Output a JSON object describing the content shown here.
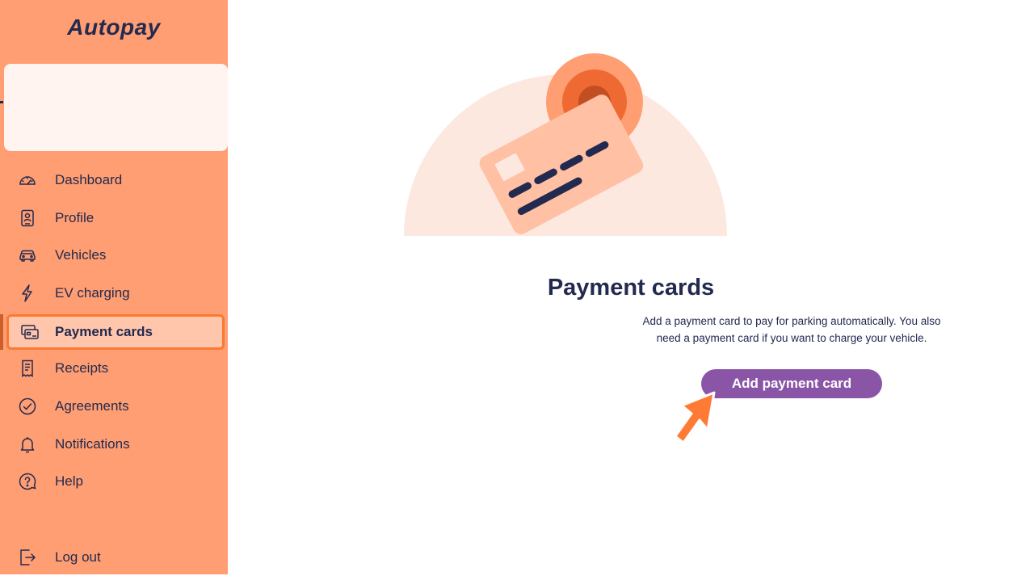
{
  "brand": {
    "name": "Autopay"
  },
  "sidebar": {
    "items": [
      {
        "label": "Dashboard",
        "icon": "speedometer-icon"
      },
      {
        "label": "Profile",
        "icon": "id-card-icon"
      },
      {
        "label": "Vehicles",
        "icon": "car-icon"
      },
      {
        "label": "EV charging",
        "icon": "lightning-icon"
      },
      {
        "label": "Payment cards",
        "icon": "credit-cards-icon",
        "active": true
      },
      {
        "label": "Receipts",
        "icon": "receipt-icon"
      },
      {
        "label": "Agreements",
        "icon": "check-circle-icon"
      },
      {
        "label": "Notifications",
        "icon": "bell-icon"
      },
      {
        "label": "Help",
        "icon": "question-icon"
      }
    ],
    "logout": {
      "label": "Log out",
      "icon": "logout-icon"
    }
  },
  "main": {
    "title": "Payment cards",
    "description": "Add a payment card to pay for parking automatically. You also need a payment card if you want to charge your vehicle.",
    "add_button": "Add payment card"
  },
  "colors": {
    "sidebar_bg": "#ff9e72",
    "active_item_bg": "#ffc6ac",
    "active_item_border": "#fa7a35",
    "text": "#232a4f",
    "button": "#8a55a6",
    "cursor": "#ff7a35"
  }
}
